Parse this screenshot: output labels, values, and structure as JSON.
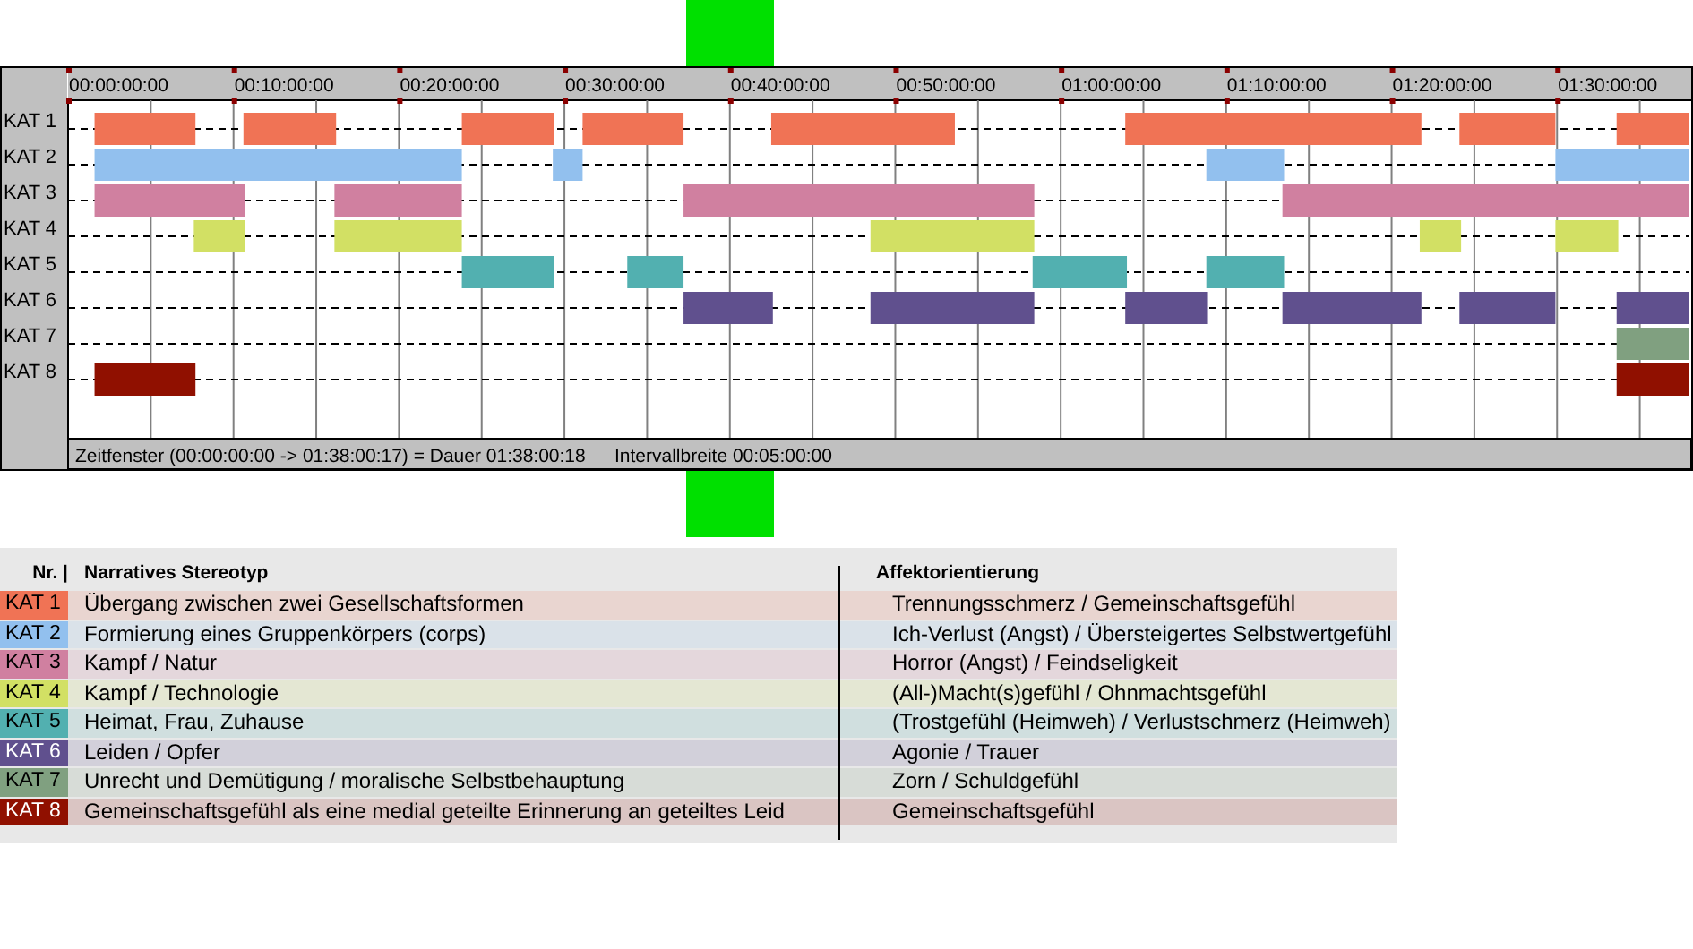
{
  "playhead": {
    "level": 0.381
  },
  "timeline": {
    "ruler_labels": [
      "00:00:00:00",
      "00:10:00:00",
      "00:20:00:00",
      "00:30:00:00",
      "00:40:00:00",
      "00:50:00:00",
      "01:00:00:00",
      "01:10:00:00",
      "01:20:00:00",
      "01:30:00:00"
    ],
    "tracks": [
      {
        "label": "KAT 1",
        "color": "#f07355"
      },
      {
        "label": "KAT 2",
        "color": "#92c0ee"
      },
      {
        "label": "KAT 3",
        "color": "#d080a0"
      },
      {
        "label": "KAT 4",
        "color": "#d2e064"
      },
      {
        "label": "KAT 5",
        "color": "#52b0b0"
      },
      {
        "label": "KAT 6",
        "color": "#60508e"
      },
      {
        "label": "KAT 7",
        "color": "#80a080"
      },
      {
        "label": "KAT 8",
        "color": "#901000"
      }
    ],
    "status_bar": {
      "window": "Zeitfenster (00:00:00:00 -> 01:38:00:17) = Dauer 01:38:00:18",
      "interval": "Intervallbreite 00:05:00:00"
    }
  },
  "legend": {
    "columns": [
      "Nr. |",
      "Narratives Stereotyp",
      "Affektorientierung"
    ],
    "rows": [
      {
        "label": "KAT 1",
        "color": "#f07355",
        "stereotype": "Übergang zwischen zwei Gesellschaftsformen",
        "affect": "Trennungsschmerz / Gemeinschaftsgefühl"
      },
      {
        "label": "KAT 2",
        "color": "#92c0ee",
        "stereotype": "Formierung eines Gruppenkörpers (corps)",
        "affect": "Ich-Verlust (Angst) / Übersteigertes Selbstwertgefühl"
      },
      {
        "label": "KAT 3",
        "color": "#d080a0",
        "stereotype": "Kampf / Natur",
        "affect": "Horror (Angst) / Feindseligkeit"
      },
      {
        "label": "KAT 4",
        "color": "#d2e064",
        "stereotype": "Kampf / Technologie",
        "affect": "(All-)Macht(s)gefühl / Ohnmachtsgefühl"
      },
      {
        "label": "KAT 5",
        "color": "#52b0b0",
        "stereotype": "Heimat, Frau, Zuhause",
        "affect": "(Trostgefühl (Heimweh) / Verlustschmerz (Heimweh)"
      },
      {
        "label": "KAT 6",
        "color": "#60508e",
        "stereotype": "Leiden / Opfer",
        "affect": "Agonie / Trauer"
      },
      {
        "label": "KAT 7",
        "color": "#80a080",
        "stereotype": "Unrecht und Demütigung / moralische Selbstbehauptung",
        "affect": "Zorn / Schuldgefühl"
      },
      {
        "label": "KAT 8",
        "color": "#901000",
        "stereotype": "Gemeinschaftsgefühl als eine medial geteilte Erinnerung an geteiltes Leid",
        "affect": "Gemeinschaftsgefühl"
      }
    ]
  }
}
